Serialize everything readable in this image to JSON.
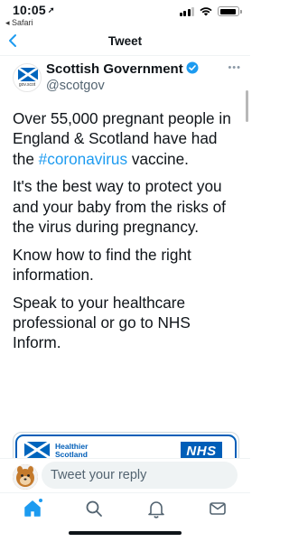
{
  "status_bar": {
    "time": "10:05",
    "back_app": "◂ Safari",
    "battery_level": 0.9,
    "signal_bars_filled": 3
  },
  "nav": {
    "title": "Tweet",
    "back_icon": "chevron-left-icon"
  },
  "tweet": {
    "author_name": "Scottish Government",
    "author_handle": "@scotgov",
    "avatar_caption": "gov.scot",
    "body": {
      "p1_before": "Over 55,000 pregnant people in England & Scotland have had the ",
      "p1_hashtag": "#coronavirus",
      "p1_after": " vaccine.",
      "p2": "It's the best way to protect you and your baby from the risks of the virus during pregnancy.",
      "p3": "Know how to find the right information.",
      "p4": "Speak to your healthcare professional or go to NHS Inform."
    }
  },
  "card": {
    "brand_line1": "Healthier",
    "brand_line2": "Scotland",
    "nhs_logo": "NHS"
  },
  "reply": {
    "placeholder": "Tweet your reply"
  },
  "tabbar": {
    "items": [
      "home-icon",
      "search-icon",
      "notifications-icon",
      "messages-icon"
    ],
    "home_has_new": true
  },
  "colors": {
    "accent": "#1d9bf0",
    "nhs_blue": "#005eb8",
    "scotland_blue": "#0065bd"
  }
}
